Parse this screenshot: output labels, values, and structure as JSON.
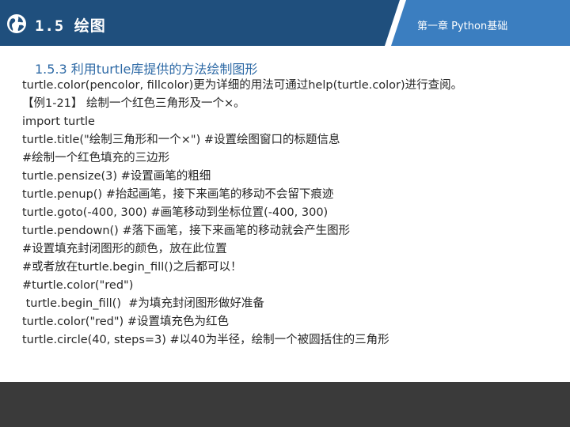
{
  "header": {
    "section_title": "1.5 绘图",
    "chapter_title": "第一章 Python基础"
  },
  "subheading": "1.5.3  利用turtle库提供的方法绘制图形",
  "lines": [
    "turtle.color(pencolor, fillcolor)更为详细的用法可通过help(turtle.color)进行查阅。",
    "【例1-21】  绘制一个红色三角形及一个×。",
    "import turtle",
    "turtle.title(\"绘制三角形和一个×\") #设置绘图窗口的标题信息",
    "#绘制一个红色填充的三边形",
    "turtle.pensize(3) #设置画笔的粗细",
    "turtle.penup()    #抬起画笔，接下来画笔的移动不会留下痕迹",
    "turtle.goto(-400, 300)  #画笔移动到坐标位置(-400, 300)",
    "turtle.pendown()  #落下画笔，接下来画笔的移动就会产生图形",
    "#设置填充封闭图形的颜色，放在此位置",
    "#或者放在turtle.begin_fill()之后都可以！",
    "#turtle.color(\"red\")",
    " turtle.begin_fill()  #为填充封闭图形做好准备",
    "turtle.color(\"red\")  #设置填充色为红色",
    "turtle.circle(40, steps=3)  #以40为半径，绘制一个被圆括住的三角形"
  ],
  "colors": {
    "header_blue": "#3b7ec0",
    "header_dark": "#1f4f7d",
    "subheading": "#2e6aa6",
    "footer": "#3a3a3a"
  },
  "icons": {
    "logo": "globe-icon"
  }
}
